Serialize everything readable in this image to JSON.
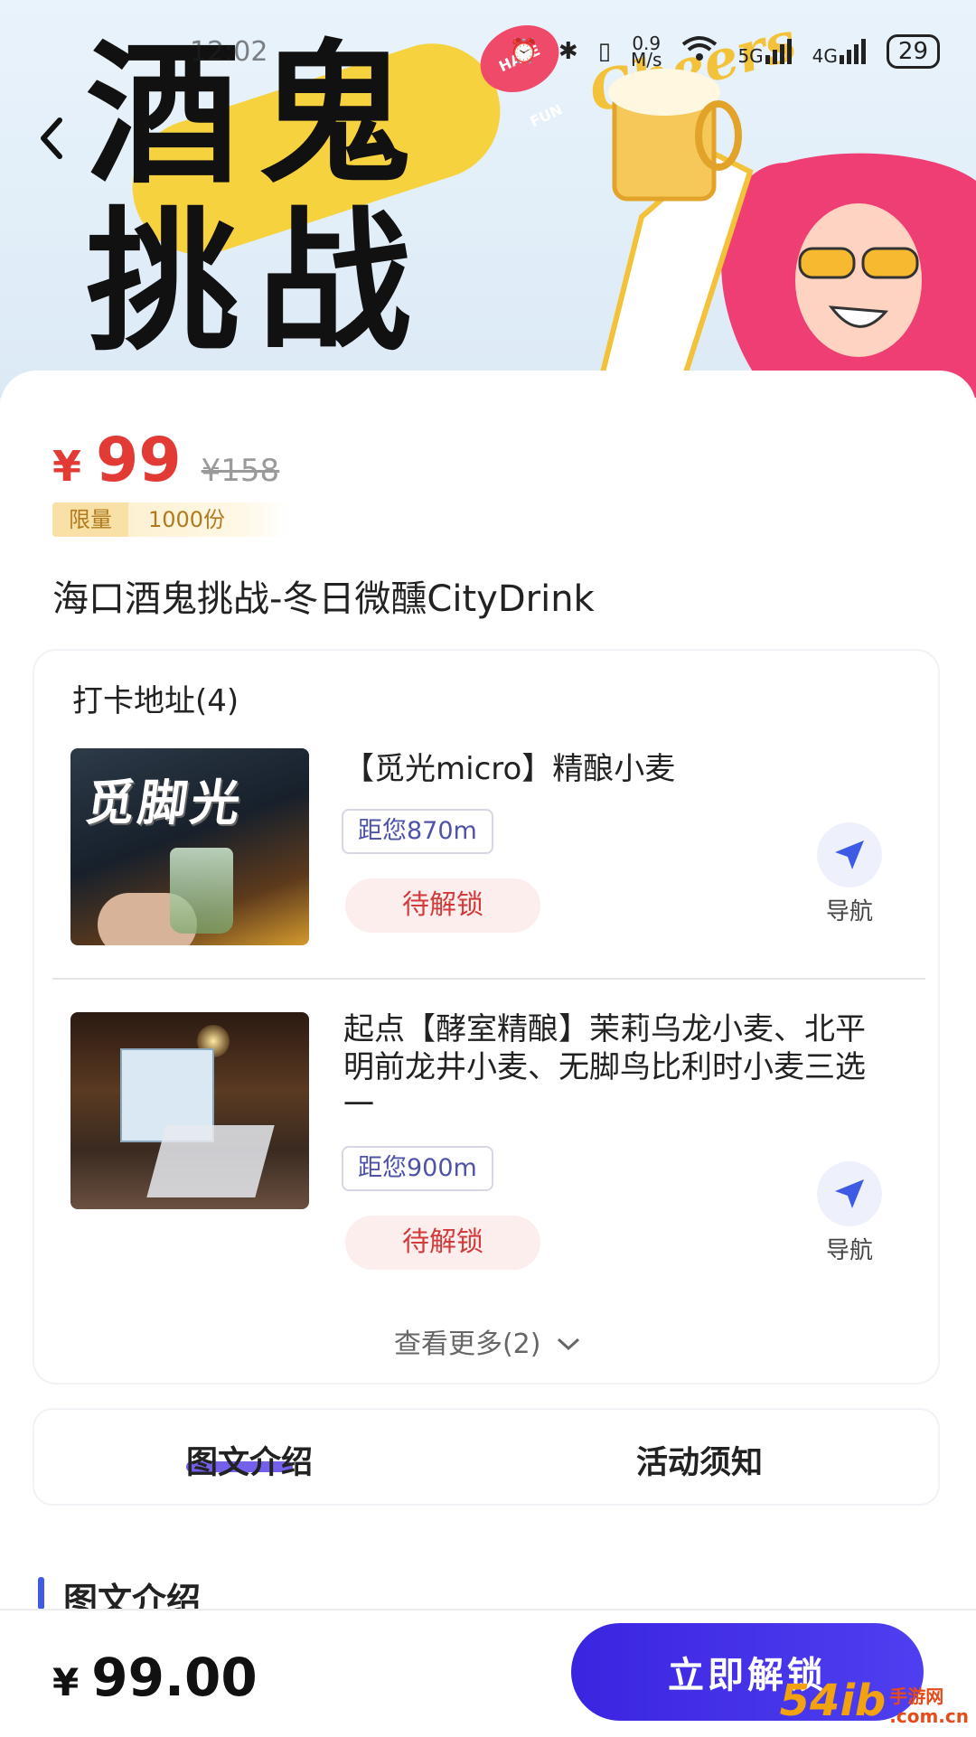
{
  "status_bar": {
    "time": "12:02",
    "network_speed": "0.9\nM/s",
    "net_5g": "5G",
    "net_4g": "4G",
    "battery": "29"
  },
  "banner": {
    "title_line1": "酒鬼",
    "title_line2": "挑战",
    "have_fun": "HAVE FUN",
    "cheers": "Cheers"
  },
  "product": {
    "currency": "¥",
    "price": "99",
    "original_price": "¥158",
    "limit_label": "限量",
    "limit_value": "1000份",
    "title": "海口酒鬼挑战-冬日微醺CityDrink"
  },
  "checkpoints": {
    "header": "打卡地址(4)",
    "items": [
      {
        "name": "【觅光micro】精酿小麦",
        "photo_sign": "觅脚光",
        "distance": "距您870m",
        "status": "待解锁",
        "nav_label": "导航"
      },
      {
        "name": "起点【酵室精酿】茉莉乌龙小麦、北平明前龙井小麦、无脚鸟比利时小麦三选一",
        "distance": "距您900m",
        "status": "待解锁",
        "nav_label": "导航"
      }
    ],
    "see_more": "查看更多(2)"
  },
  "tabs": {
    "intro": "图文介绍",
    "notice": "活动须知"
  },
  "section": {
    "title": "图文介绍"
  },
  "bottom_bar": {
    "currency": "¥",
    "price": "99.00",
    "cta_label": "立即解锁"
  },
  "watermark": {
    "main": "54ib",
    "sub": "手游网\n.com.cn"
  },
  "colors": {
    "price_red": "#e23a35",
    "cta_purple": "#3a25e0",
    "tab_accent": "#5b44e8",
    "nav_blue": "#3f5be6"
  }
}
